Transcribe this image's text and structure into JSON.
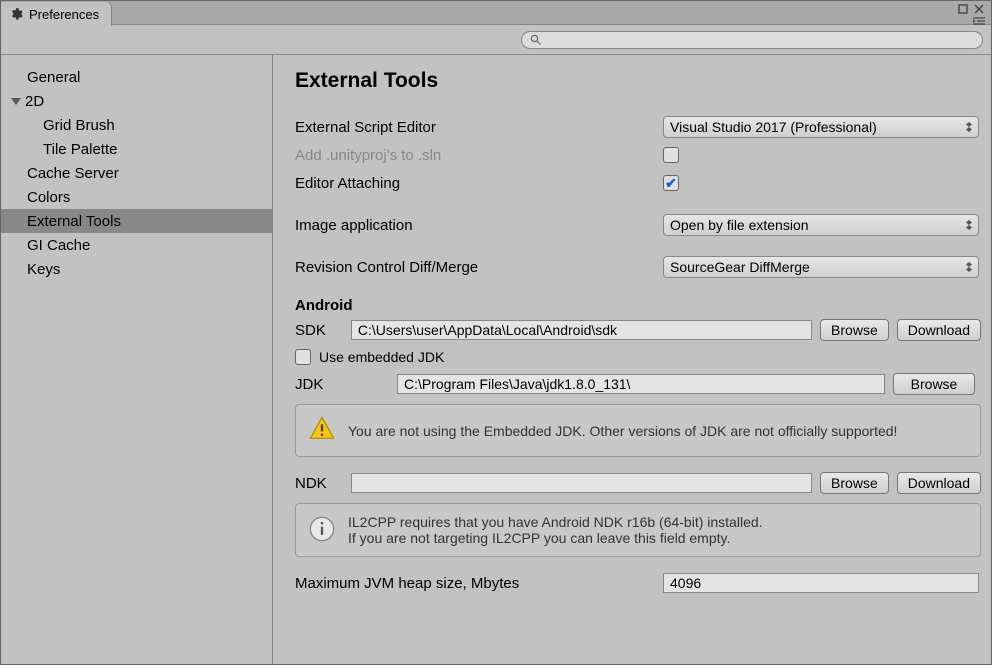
{
  "window": {
    "title": "Preferences"
  },
  "sidebar": {
    "items": [
      {
        "label": "General"
      },
      {
        "label": "2D",
        "expanded": true
      },
      {
        "label": "Grid Brush",
        "indent": true
      },
      {
        "label": "Tile Palette",
        "indent": true
      },
      {
        "label": "Cache Server"
      },
      {
        "label": "Colors"
      },
      {
        "label": "External Tools",
        "selected": true
      },
      {
        "label": "GI Cache"
      },
      {
        "label": "Keys"
      }
    ]
  },
  "main": {
    "title": "External Tools",
    "externalScriptEditor": {
      "label": "External Script Editor",
      "value": "Visual Studio 2017 (Professional)"
    },
    "addUnityProj": {
      "label": "Add .unityproj's to .sln",
      "checked": false
    },
    "editorAttaching": {
      "label": "Editor Attaching",
      "checked": true
    },
    "imageApplication": {
      "label": "Image application",
      "value": "Open by file extension"
    },
    "revisionControl": {
      "label": "Revision Control Diff/Merge",
      "value": "SourceGear DiffMerge"
    },
    "android": {
      "heading": "Android",
      "sdk": {
        "label": "SDK",
        "path": "C:\\Users\\user\\AppData\\Local\\Android\\sdk"
      },
      "useEmbeddedJdk": {
        "label": "Use embedded JDK",
        "checked": false
      },
      "jdk": {
        "label": "JDK",
        "path": "C:\\Program Files\\Java\\jdk1.8.0_131\\"
      },
      "jdkWarning": "You are not using the Embedded JDK. Other versions of JDK are not officially supported!",
      "ndk": {
        "label": "NDK",
        "path": ""
      },
      "ndkInfoLine1": "IL2CPP requires that you have Android NDK r16b (64-bit) installed.",
      "ndkInfoLine2": "If you are not targeting IL2CPP you can leave this field empty.",
      "heap": {
        "label": "Maximum JVM heap size, Mbytes",
        "value": "4096"
      }
    },
    "buttons": {
      "browse": "Browse",
      "download": "Download"
    }
  }
}
